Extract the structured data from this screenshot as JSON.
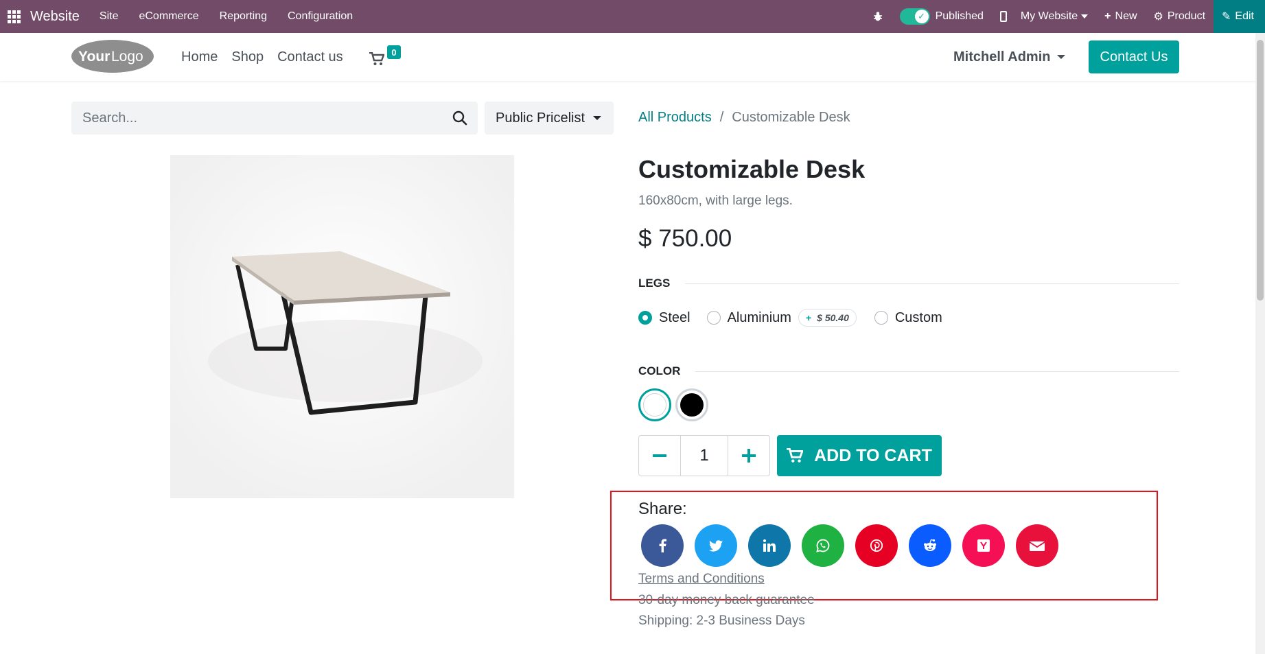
{
  "topbar": {
    "brand": "Website",
    "menu": [
      "Site",
      "eCommerce",
      "Reporting",
      "Configuration"
    ],
    "published_label": "Published",
    "my_website_label": "My Website",
    "new_label": "New",
    "product_label": "Product",
    "edit_label": "Edit",
    "background_color": "#714B67",
    "edit_color": "#017e84"
  },
  "header": {
    "logo_text": "YourLogo",
    "nav": [
      "Home",
      "Shop",
      "Contact us"
    ],
    "cart_count": "0",
    "user_name": "Mitchell Admin",
    "contact_button": "Contact Us",
    "accent_color": "#00A09D"
  },
  "search": {
    "placeholder": "Search...",
    "pricelist_label": "Public Pricelist"
  },
  "breadcrumb": {
    "parent": "All Products",
    "separator": "/",
    "current": "Customizable Desk"
  },
  "product": {
    "title": "Customizable Desk",
    "description": "160x80cm, with large legs.",
    "price": "$ 750.00",
    "attributes": {
      "legs": {
        "label": "LEGS",
        "options": [
          {
            "label": "Steel",
            "selected": true
          },
          {
            "label": "Aluminium",
            "selected": false,
            "extra": "$ 50.40",
            "extra_prefix": "+"
          },
          {
            "label": "Custom",
            "selected": false
          }
        ]
      },
      "color": {
        "label": "COLOR",
        "options": [
          {
            "name": "white",
            "color": "#ffffff",
            "selected": true
          },
          {
            "name": "black",
            "color": "#000000",
            "selected": false
          }
        ]
      }
    },
    "quantity": "1",
    "add_to_cart_label": "ADD TO CART"
  },
  "share": {
    "label": "Share:",
    "networks": [
      {
        "name": "facebook-icon",
        "glyph": "f",
        "color": "#3b5998"
      },
      {
        "name": "twitter-icon",
        "glyph": "t",
        "color": "#1da1f2"
      },
      {
        "name": "linkedin-icon",
        "glyph": "in",
        "color": "#0e76a8"
      },
      {
        "name": "whatsapp-icon",
        "glyph": "w",
        "color": "#1fb141"
      },
      {
        "name": "pinterest-icon",
        "glyph": "p",
        "color": "#e60023"
      },
      {
        "name": "reddit-icon",
        "glyph": "r",
        "color": "#0b5cff"
      },
      {
        "name": "hacker-news-icon",
        "glyph": "Y",
        "color": "#f50f55"
      },
      {
        "name": "email-icon",
        "glyph": "@",
        "color": "#e8113c"
      }
    ]
  },
  "info": {
    "terms": "Terms and Conditions",
    "guarantee": "30-day money back guarantee",
    "shipping": "Shipping: 2-3 Business Days"
  }
}
